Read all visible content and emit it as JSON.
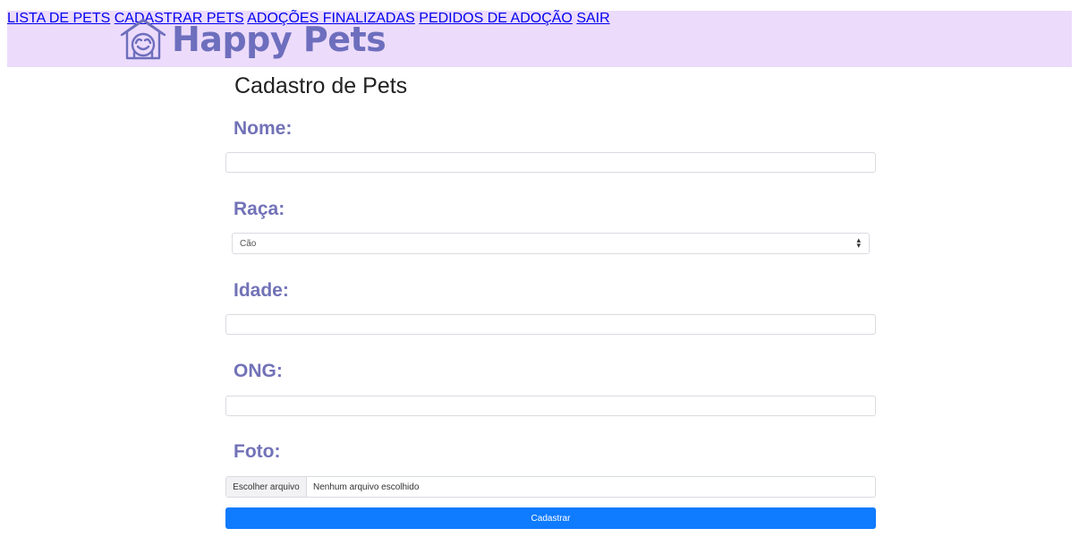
{
  "header": {
    "brand": "Happy Pets",
    "nav": [
      "LISTA DE PETS",
      "CADASTRAR PETS",
      "ADOÇÕES FINALIZADAS",
      "PEDIDOS DE ADOÇÃO",
      "SAIR"
    ]
  },
  "form": {
    "title": "Cadastro de Pets",
    "nome_label": "Nome:",
    "nome_value": "",
    "raca_label": "Raça:",
    "raca_selected": "Cão",
    "idade_label": "Idade:",
    "idade_value": "",
    "ong_label": "ONG:",
    "ong_value": "",
    "foto_label": "Foto:",
    "file_button": "Escolher arquivo",
    "file_status": "Nenhum arquivo escolhido",
    "submit_label": "Cadastrar"
  },
  "colors": {
    "header_bg": "#ecdbfa",
    "brand": "#6d6ebd",
    "label": "#7272b8",
    "primary": "#0f7bff"
  }
}
